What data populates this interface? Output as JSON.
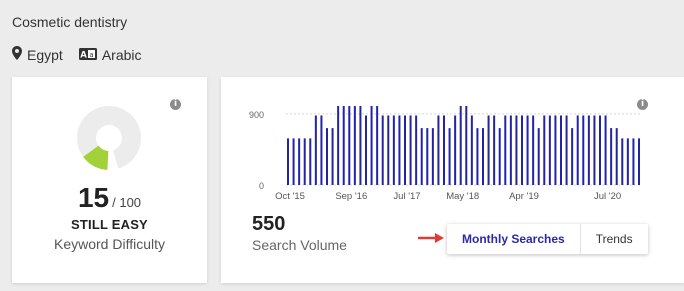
{
  "keyword": "Cosmetic dentistry",
  "location": {
    "country": "Egypt",
    "language": "Arabic",
    "location_icon": "map-pin-icon",
    "language_icon": "translate-icon"
  },
  "keyword_difficulty": {
    "score": "15",
    "max_label": "/ 100",
    "score_value": 15,
    "score_max": 100,
    "status": "STILL EASY",
    "caption": "Keyword Difficulty",
    "info_icon": "i",
    "colors": {
      "fill": "#a3d13a",
      "track": "#ececec"
    }
  },
  "search_volume": {
    "value": "550",
    "caption": "Search Volume",
    "info_icon": "i",
    "toggle": {
      "active": "Monthly Searches",
      "inactive": "Trends"
    },
    "accent_color": "#2a2aa8",
    "arrow_color": "#e03c36"
  },
  "chart_data": {
    "type": "bar",
    "color": "#2323a6",
    "y_ticks": [
      "900",
      "0"
    ],
    "ylim": [
      0,
      1000
    ],
    "x_tick_labels": [
      "Oct '15",
      "Sep '16",
      "Jul '17",
      "May '18",
      "Apr '19",
      "Jul '20"
    ],
    "x_tick_indices": [
      0,
      11,
      21,
      31,
      42,
      57
    ],
    "values": [
      590,
      590,
      590,
      590,
      590,
      880,
      880,
      720,
      720,
      1000,
      1000,
      1000,
      1000,
      1000,
      880,
      1000,
      1000,
      880,
      880,
      880,
      880,
      880,
      880,
      880,
      720,
      720,
      720,
      880,
      880,
      720,
      880,
      1000,
      1000,
      880,
      720,
      720,
      880,
      880,
      720,
      880,
      880,
      880,
      880,
      880,
      880,
      720,
      880,
      880,
      880,
      880,
      880,
      720,
      880,
      880,
      880,
      880,
      880,
      880,
      720,
      720,
      590,
      590,
      590,
      590
    ]
  }
}
